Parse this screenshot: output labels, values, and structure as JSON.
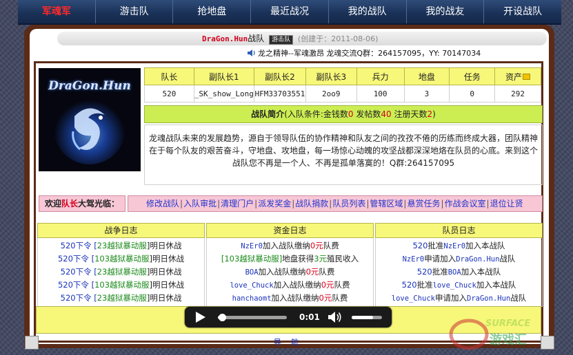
{
  "nav": {
    "brand": "军魂军",
    "items": [
      "游击队",
      "抢地盘",
      "最近战况",
      "我的战队",
      "我的战友",
      "开设战队"
    ]
  },
  "header": {
    "team_name": "DraGon.Hun",
    "team_suffix": "战队",
    "badge": "游击队",
    "created": "(创建于：2011-08-06)",
    "slogan": "龙之精神--军魂激昂 龙魂交流Q群：264157095，YY: 70147034"
  },
  "logo": {
    "text": "DraGon.Hun"
  },
  "stats": {
    "headers": [
      "队长",
      "副队长1",
      "副队长2",
      "副队长3",
      "兵力",
      "地盘",
      "任务",
      "资产"
    ],
    "values": [
      "520",
      "_SK_show_Long",
      "HFM33703551",
      "2oo9",
      "100",
      "3",
      "0",
      "292"
    ]
  },
  "intro": {
    "title": "战队简介",
    "cond_prefix": "(入队条件:金钱数",
    "money": "0",
    "posts_label": " 发帖数",
    "posts": "40",
    "days_label": " 注册天数",
    "days": "2",
    "cond_suffix": ")",
    "text": "龙魂战队未来的发展趋势，源自于领导队伍的协作精神和队友之间的孜孜不倦的历练而终成大器，团队精神在于每个队友的艰苦奋斗，守地盘、攻地盘，每一场惊心动魄的攻坚战都深深地烙在队员的心底。来到这个战队您不再是一个人、不再是孤单落寞的！Q群:264157095"
  },
  "welcome": {
    "prefix": "欢迎",
    "role": "队长",
    "suffix": "大驾光临："
  },
  "admin_links": [
    "修改战队",
    "入队审批",
    "清理门户",
    "派发奖金",
    "战队捐款",
    "队员列表",
    "管辖区域",
    "悬赏任务",
    "作战会议室",
    "退位让贤"
  ],
  "logs": {
    "battle": {
      "title": "战争日志",
      "entries": [
        {
          "a": "520下令 [",
          "b": "23越狱暴动服",
          "c": "]明日休战"
        },
        {
          "a": "520下令 [",
          "b": "103越狱暴动服",
          "c": "]明日休战"
        },
        {
          "a": "520下令 [",
          "b": "23越狱暴动服",
          "c": "]明日休战"
        },
        {
          "a": "520下令 [",
          "b": "103越狱暴动服",
          "c": "]明日休战"
        },
        {
          "a": "520下令 [",
          "b": "23越狱暴动服",
          "c": "]明日休战"
        }
      ]
    },
    "funds": {
      "title": "资金日志",
      "entries": [
        {
          "a": "NzEr0",
          "b": "加入战队缴纳",
          "c": "0元",
          "d": "队费"
        },
        {
          "a": "[103越狱暴动服]",
          "b": "地盘获得",
          "c": "3元",
          "d": "殖民收入"
        },
        {
          "a": "BOA",
          "b": "加入战队缴纳",
          "c": "0元",
          "d": "队费"
        },
        {
          "a": "love_Chuck",
          "b": "加入战队缴纳",
          "c": "0元",
          "d": "队费"
        },
        {
          "a": "hanchaomt",
          "b": "加入战队缴纳",
          "c": "0元",
          "d": "队费"
        }
      ]
    },
    "members": {
      "title": "队员日志",
      "entries": [
        {
          "a": "520",
          "b": "批准",
          "c": "NzEr0",
          "d": "加入本战队"
        },
        {
          "a": "NzEr0",
          "b": "申请加入",
          "c": "DraGon.Hun",
          "d": "战队"
        },
        {
          "a": "520",
          "b": "批准",
          "c": "BOA",
          "d": "加入本战队"
        },
        {
          "a": "520",
          "b": "批准",
          "c": "love_Chuck",
          "d": "加入本战队"
        },
        {
          "a": "love_Chuck",
          "b": "申请加入",
          "c": "DraGon.Hun",
          "d": "战队"
        }
      ]
    }
  },
  "player": {
    "time": "0:01",
    "progress": 0.06,
    "volume": 0.7
  },
  "bottom_links": [
    "导",
    "航"
  ],
  "watermark": "SURFACE 游戏汇"
}
